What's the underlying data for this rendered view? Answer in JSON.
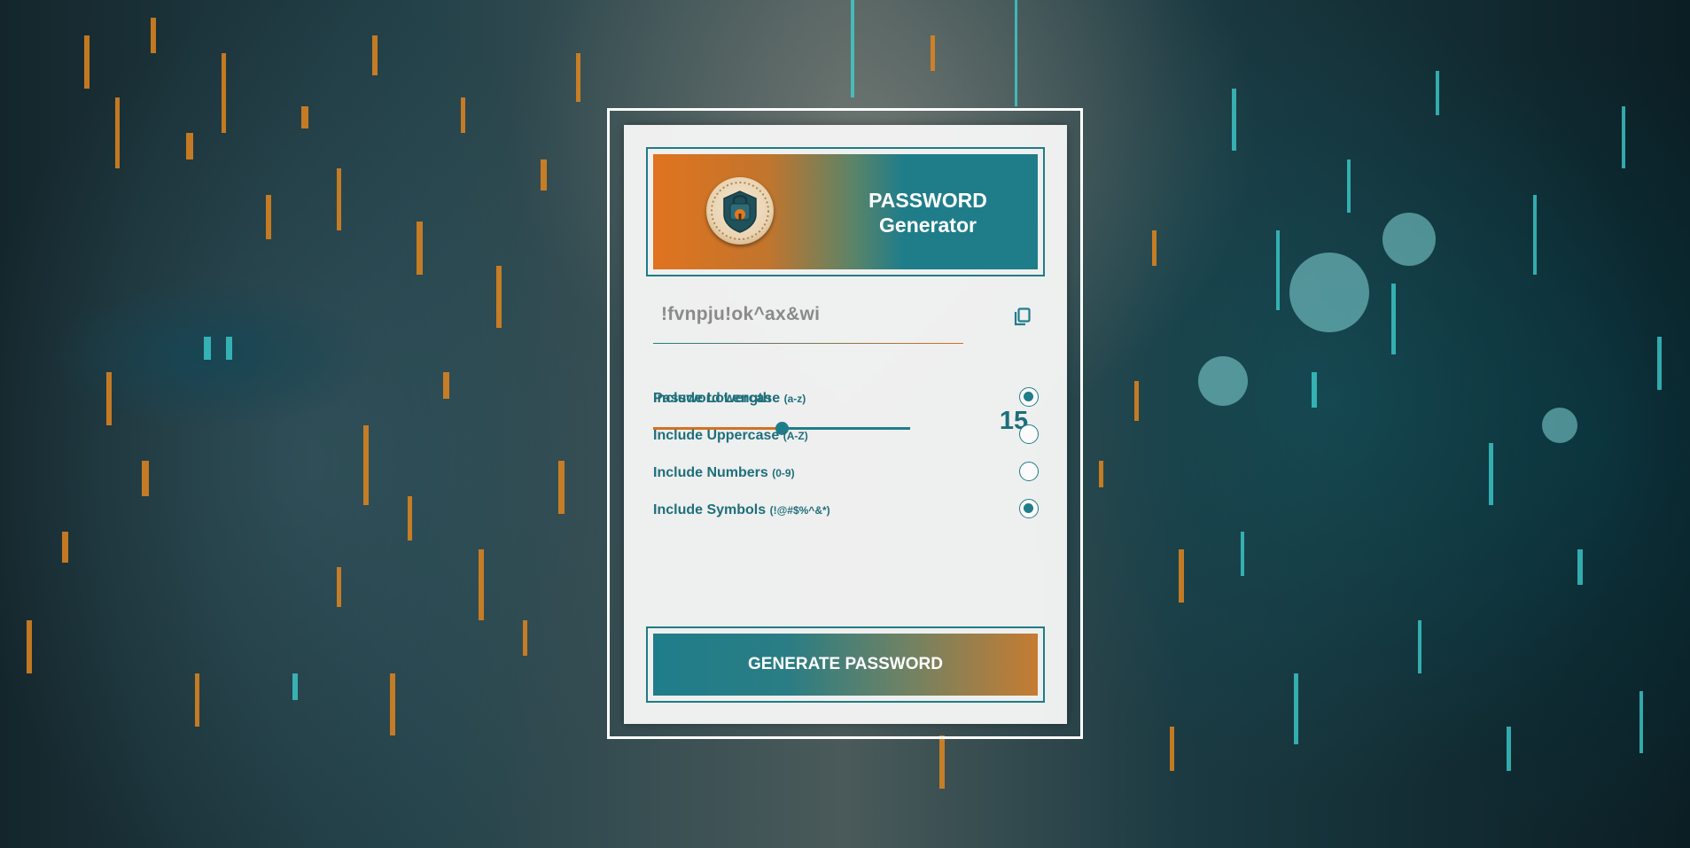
{
  "header": {
    "title_line1": "PASSWORD",
    "title_line2": "Generator",
    "logo_icon": "padlock-shield-icon"
  },
  "password": {
    "value": "!fvnpju!ok^ax&wi",
    "copy_icon": "copy-icon"
  },
  "length": {
    "label": "Password Length",
    "value": "15",
    "slider_fraction": 0.5
  },
  "options": [
    {
      "label": "Include Lowercase",
      "hint": "(a-z)",
      "checked": true
    },
    {
      "label": "Include Uppercase",
      "hint": "(A-Z)",
      "checked": false
    },
    {
      "label": "Include Numbers",
      "hint": "(0-9)",
      "checked": false
    },
    {
      "label": "Include Symbols",
      "hint": "(!@#$%^&*)",
      "checked": true
    }
  ],
  "generate_button": {
    "label": "GENERATE PASSWORD"
  },
  "colors": {
    "teal": "#1f7d8a",
    "orange": "#d27222",
    "text": "#1e6f7a"
  }
}
